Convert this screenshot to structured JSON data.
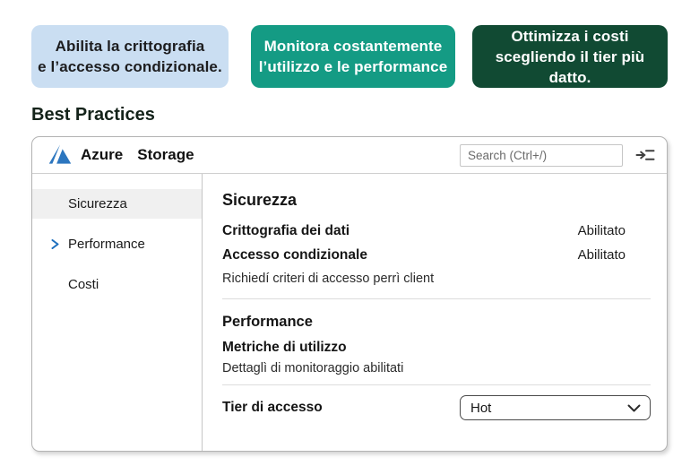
{
  "callouts": [
    {
      "lines": [
        "Abilita la crittografia",
        "e l’accesso condizionale."
      ]
    },
    {
      "lines": [
        "Monitora costantemente",
        "l’utilizzo e le performance"
      ]
    },
    {
      "lines": [
        "Ottimizza i costi",
        "scegliendo il tier più datto."
      ]
    }
  ],
  "section_heading": "Best Practices",
  "window": {
    "brand": "Azure",
    "product": "Storage",
    "search_placeholder": "Search (Ctrl+/)",
    "sidebar": {
      "items": [
        {
          "label": "Sicurezza",
          "selected": true
        },
        {
          "label": "Performance",
          "selected": false
        },
        {
          "label": "Costi",
          "selected": false
        }
      ]
    },
    "content": {
      "security": {
        "title": "Sicurezza",
        "rows": [
          {
            "label": "Crittografia dei dati",
            "value": "Abilitato"
          },
          {
            "label": "Accesso condizionale",
            "value": "Abilitato"
          }
        ],
        "caption": "Richiedí criteri di accesso perrì client"
      },
      "performance": {
        "title": "Performance",
        "subtitle": "Metriche di utilizzo",
        "caption": "Dettaglì di monitoraggio abilitati"
      },
      "tier": {
        "label": "Tier di accesso",
        "selected_option": "Hot"
      }
    }
  },
  "colors": {
    "callout_blue_bg": "#cadef2",
    "callout_teal_bg": "#149b84",
    "callout_green_bg": "#114a33",
    "azure_logo_blue": "#2c76bf",
    "sidebar_chevron_blue": "#1e6fbe",
    "selected_item_bg": "#f0f0f0"
  }
}
